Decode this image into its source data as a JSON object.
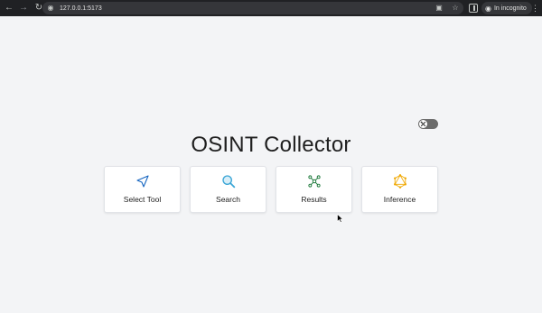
{
  "browser": {
    "url": "127.0.0.1:5173",
    "incognito_label": "In incognito"
  },
  "page": {
    "title": "OSINT Collector",
    "cards": [
      {
        "label": "Select Tool",
        "icon": "send-icon",
        "color": "#1565c0"
      },
      {
        "label": "Search",
        "icon": "search-icon",
        "color": "#3aa6d6"
      },
      {
        "label": "Results",
        "icon": "graph-icon",
        "color": "#1e7a3c"
      },
      {
        "label": "Inference",
        "icon": "graphql-icon",
        "color": "#f0a800"
      }
    ]
  },
  "theme_toggle": {
    "state": "off"
  }
}
